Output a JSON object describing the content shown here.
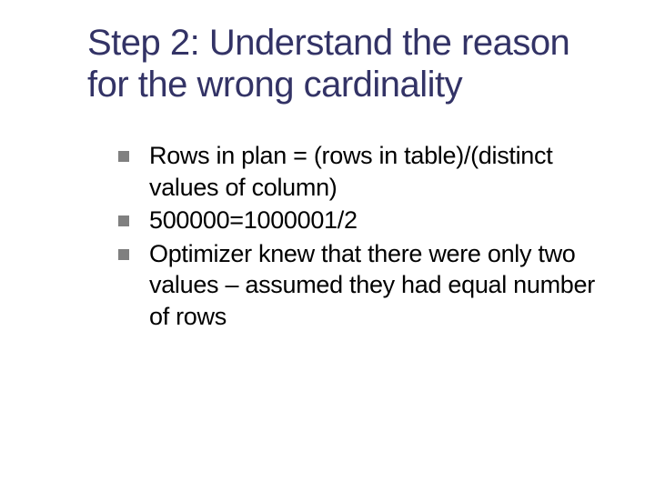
{
  "slide": {
    "title": "Step 2: Understand the reason for the wrong cardinality",
    "bullets": [
      {
        "text": "Rows in plan = (rows in table)/(distinct values of column)"
      },
      {
        "text": "500000=1000001/2"
      },
      {
        "text": "Optimizer knew that there were only two values – assumed they had equal number of rows"
      }
    ]
  }
}
